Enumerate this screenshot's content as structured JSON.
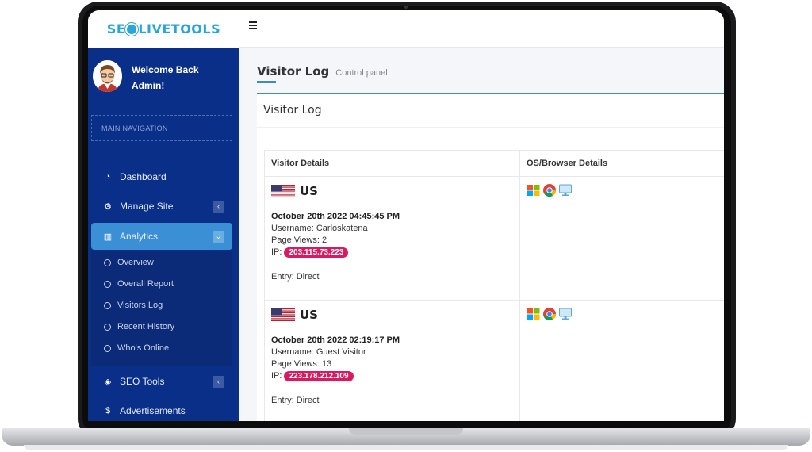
{
  "brand": {
    "left": "SE",
    "right": "LIVETOOLS"
  },
  "user": {
    "welcome_line1": "Welcome Back",
    "welcome_line2": "Admin!"
  },
  "sidebar": {
    "nav_header": "MAIN NAVIGATION",
    "items": [
      {
        "label": "Dashboard",
        "icon": "dashboard-icon"
      },
      {
        "label": "Manage Site",
        "icon": "cogs-icon"
      },
      {
        "label": "Analytics",
        "icon": "bar-chart-icon"
      },
      {
        "label": "SEO Tools",
        "icon": "cube-icon"
      },
      {
        "label": "Advertisements",
        "icon": "dollar-icon"
      }
    ],
    "analytics_sub": [
      "Overview",
      "Overall Report",
      "Visitors Log",
      "Recent History",
      "Who's Online"
    ]
  },
  "page": {
    "title": "Visitor Log",
    "subtitle": "Control panel"
  },
  "box": {
    "title": "Visitor Log"
  },
  "table": {
    "headers": [
      "Visitor Details",
      "OS/Browser Details"
    ],
    "rows": [
      {
        "country": "US",
        "date": "October 20th 2022 04:45:45 PM",
        "username": "Username: Carloskatena",
        "page_views": "Page Views: 2",
        "ip_label": "IP:",
        "ip": "203.115.73.223",
        "entry": "Entry: Direct"
      },
      {
        "country": "US",
        "date": "October 20th 2022 02:19:17 PM",
        "username": "Username: Guest Visitor",
        "page_views": "Page Views: 13",
        "ip_label": "IP:",
        "ip": "223.178.212.109",
        "entry": "Entry: Direct"
      }
    ]
  },
  "colors": {
    "sidebar": "#0a2f88",
    "active": "#3b8fd4",
    "accent": "#3c8dbc",
    "ip_badge": "#d81b60",
    "brand": "#2aa5d6"
  }
}
